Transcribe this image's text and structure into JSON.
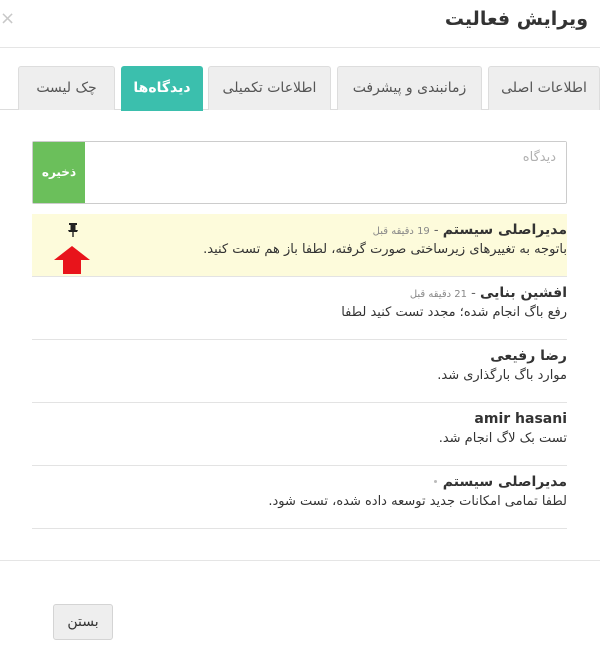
{
  "dialog": {
    "title": "ویرایش فعالیت",
    "close_symbol": "×"
  },
  "tabs": [
    {
      "label": "اطلاعات اصلی",
      "active": false
    },
    {
      "label": "زمانبندی و پیشرفت",
      "active": false
    },
    {
      "label": "اطلاعات تکمیلی",
      "active": false
    },
    {
      "label": "دیدگاه‌ها",
      "active": true
    },
    {
      "label": "چک لیست",
      "active": false
    }
  ],
  "comment_form": {
    "placeholder": "دیدگاه",
    "save_label": "ذخیره",
    "save_color": "#6bbf5b"
  },
  "comments": [
    {
      "author": "مدیراصلی سیستم",
      "separator": " - ",
      "time": "19 دقیقه قبل",
      "text": "باتوجه به تغییرهای زیرساختی صورت گرفته، لطفا باز هم تست کنید.",
      "pinned": true
    },
    {
      "author": "افشین بنایی",
      "separator": " - ",
      "time": "21 دقیقه قبل",
      "text": "رفع باگ انجام شده؛ مجدد تست کنید لطفا",
      "pinned": false
    },
    {
      "author": "رضا رفیعی",
      "separator": "",
      "time": "",
      "text": "موارد باگ بارگذاری شد.",
      "pinned": false
    },
    {
      "author": "amir hasani",
      "separator": "",
      "time": "",
      "text": "تست بک لاگ انجام شد.",
      "pinned": false
    },
    {
      "author": "مدیراصلی سیستم",
      "separator": "",
      "time": "",
      "text": "لطفا تمامی امکانات جدید توسعه داده شده، تست شود.",
      "pinned": false
    }
  ],
  "icons": {
    "pin": "pin-icon",
    "arrow": "arrow-up-icon"
  },
  "colors": {
    "active_tab": "#3bbfad",
    "pinned_bg": "#fdfbdb",
    "arrow": "#e8141b"
  },
  "footer": {
    "close_label": "بستن"
  }
}
